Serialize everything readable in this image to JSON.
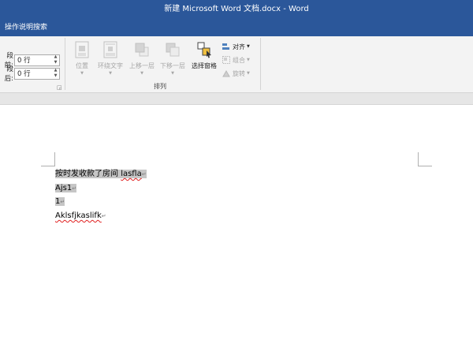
{
  "window": {
    "title": "新建 Microsoft Word 文档.docx  -  Word"
  },
  "tellme": {
    "label": "操作说明搜索"
  },
  "spacing": {
    "before_label": "段前:",
    "before_value": "0 行",
    "after_label": "段后:",
    "after_value": "0 行"
  },
  "arrange": {
    "group_label": "排列",
    "buttons": [
      {
        "label": "位置"
      },
      {
        "label": "环绕文字"
      },
      {
        "label": "上移一层"
      },
      {
        "label": "下移一层"
      },
      {
        "label": "选择窗格"
      }
    ],
    "align_label": "对齐",
    "group_label_small": "组合",
    "rotate_label": "旋转"
  },
  "document": {
    "lines": [
      {
        "prefix": "按时发收款了房间 ",
        "word": "lasfla",
        "mark": "↵"
      },
      {
        "prefix": "Ajs1",
        "word": "",
        "mark": "↵"
      },
      {
        "prefix": "1",
        "word": "",
        "mark": "↵"
      },
      {
        "prefix": "",
        "word": "Aklsfjkaslifk",
        "mark": "↵"
      }
    ]
  },
  "colors": {
    "accent": "#2b579a",
    "selection": "#c6c6c6",
    "spell": "#e02020"
  }
}
